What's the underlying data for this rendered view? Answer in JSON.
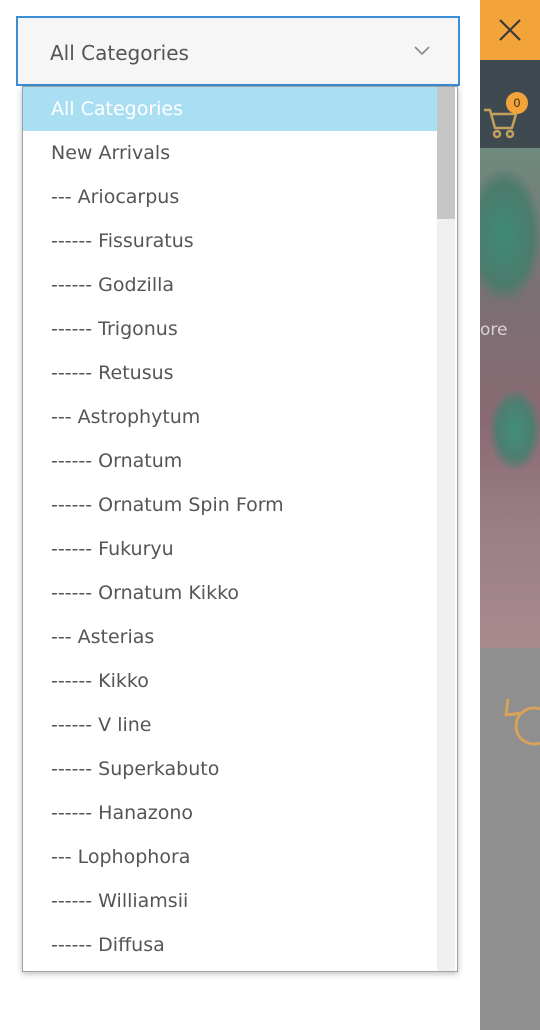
{
  "select": {
    "value": "All Categories"
  },
  "dropdown": {
    "options": [
      "All Categories",
      "New Arrivals",
      "--- Ariocarpus",
      "------ Fissuratus",
      "------ Godzilla",
      "------ Trigonus",
      "------ Retusus",
      "--- Astrophytum",
      "------ Ornatum",
      "------ Ornatum Spin Form",
      "------ Fukuryu",
      "------ Ornatum Kikko",
      "--- Asterias",
      "------ Kikko",
      "------ V line",
      "------ Superkabuto",
      "------ Hanazono",
      "--- Lophophora",
      "------ Williamsii",
      "------ Diffusa"
    ]
  },
  "background": {
    "cart_count": "0",
    "hero_text_fragment": "ore"
  },
  "colors": {
    "accent_orange": "#f2a33a",
    "select_border": "#3b8fd6",
    "selected_option_bg": "#a9def3"
  }
}
